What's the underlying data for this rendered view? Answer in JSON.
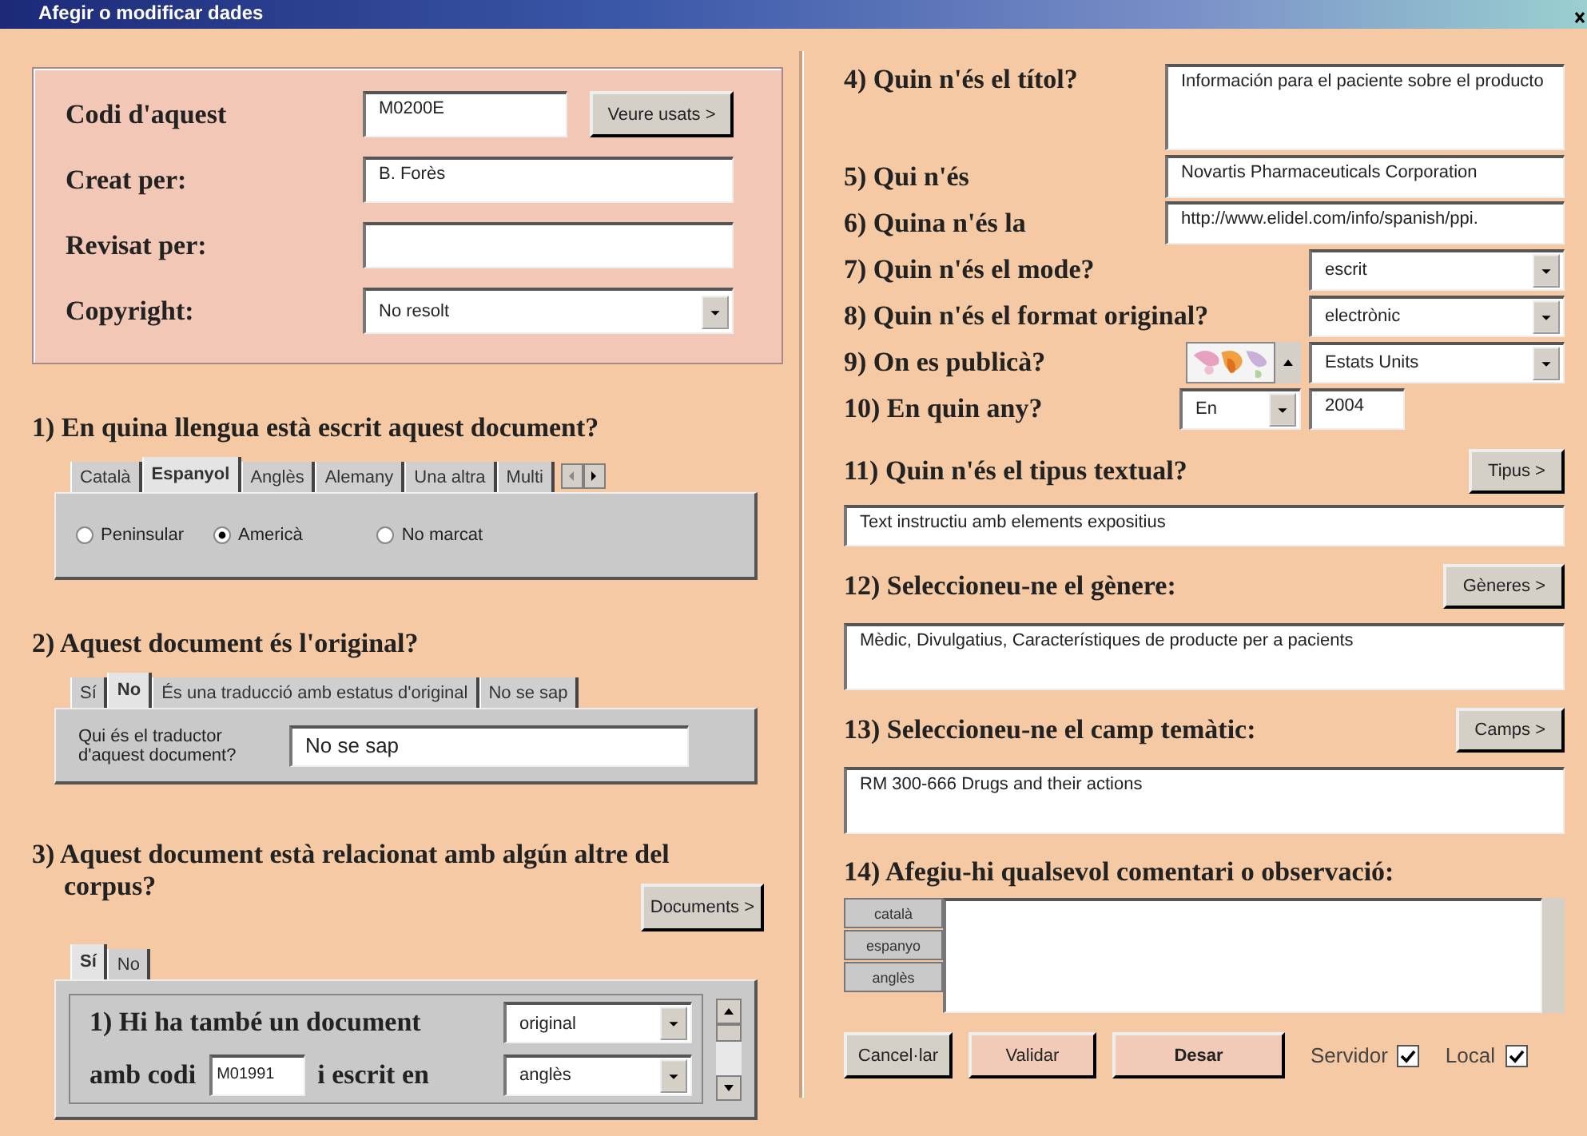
{
  "window": {
    "title": "Afegir o modificar dades"
  },
  "record": [
    {
      "label": "Codi d'aquest",
      "kind": "text",
      "value": "M0200E",
      "button": "Veure usats >"
    },
    {
      "label": "Creat per:",
      "kind": "text",
      "value": "B. Forès"
    },
    {
      "label": "Revisat per:",
      "kind": "text"
    },
    {
      "label": "Copyright:",
      "kind": "select",
      "value": "No resolt"
    }
  ],
  "language": {
    "heading": "1) En quina llengua està escrit aquest document?",
    "tabs": [
      {
        "label": "Català",
        "selected": false
      },
      {
        "label": "Espanyol",
        "selected": true
      },
      {
        "label": "Anglès",
        "selected": false
      },
      {
        "label": "Alemany",
        "selected": false
      },
      {
        "label": "Una altra",
        "selected": false
      },
      {
        "label": "Multi",
        "selected": false
      }
    ],
    "options": [
      {
        "label": "Peninsular",
        "selected": false
      },
      {
        "label": "Americà",
        "selected": true
      },
      {
        "label": "No marcat",
        "selected": false
      }
    ]
  },
  "original": {
    "heading": "2) Aquest document és l'original?",
    "tabs": [
      {
        "label": "Sí",
        "selected": false
      },
      {
        "label": "No",
        "selected": true
      },
      {
        "label": "És una traducció amb estatus d'original",
        "selected": false
      },
      {
        "label": "No se sap",
        "selected": false
      }
    ],
    "field_label": "Qui és el traductor d'aquest document?",
    "field_value": "No se sap"
  },
  "related": {
    "heading": "3) Aquest document està relacionat amb algún altre del corpus?",
    "button": "Documents >",
    "tabs": [
      {
        "label": "Sí",
        "selected": true
      },
      {
        "label": "No",
        "selected": false
      }
    ],
    "line_1": "1) Hi ha també un document",
    "type": "original",
    "line_2a": "amb codi",
    "code": "M01991",
    "line_2b": "i escrit en",
    "language": "anglès"
  },
  "details": [
    {
      "label": "4) Quin n'és el títol?",
      "kind": "textarea",
      "value": "Información para el paciente sobre el producto"
    },
    {
      "label": "5) Qui n'és",
      "kind": "text",
      "value": "Novartis Pharmaceuticals Corporation"
    },
    {
      "label": "6) Quina n'és la",
      "kind": "text",
      "value": "http://www.elidel.com/info/spanish/ppi."
    },
    {
      "label": "7) Quin n'és el mode?",
      "kind": "select",
      "value": "escrit"
    },
    {
      "label": "8) Quin n'és el format original?",
      "kind": "select",
      "value": "electrònic"
    },
    {
      "label": "9) On es publicà?",
      "kind": "place",
      "value": "Estats Units"
    },
    {
      "label": "10) En quin any?",
      "kind": "year",
      "prefix": "En",
      "value": "2004"
    }
  ],
  "classification": [
    {
      "label": "11) Quin n'és el tipus textual?",
      "button": "Tipus >",
      "kind": "line",
      "value": "Text instructiu amb elements expositius"
    },
    {
      "label": "12) Seleccioneu-ne el gènere:",
      "button": "Gèneres >",
      "kind": "box",
      "value": "Mèdic, Divulgatius, Característiques de producte per a pacients"
    },
    {
      "label": "13) Seleccioneu-ne el camp temàtic:",
      "button": "Camps >",
      "kind": "box",
      "value": "RM 300-666 Drugs and their actions"
    }
  ],
  "comments": {
    "label": "14) Afegiu-hi qualsevol comentari o observació:",
    "languages": [
      "català",
      "espanyo",
      "anglès"
    ]
  },
  "actions": [
    {
      "label": "Cancel·lar",
      "primary": false
    },
    {
      "label": "Validar",
      "primary": false
    },
    {
      "label": "Desar",
      "primary": true
    }
  ],
  "targets": [
    {
      "label": "Servidor",
      "checked": true
    },
    {
      "label": "Local",
      "checked": true
    }
  ]
}
